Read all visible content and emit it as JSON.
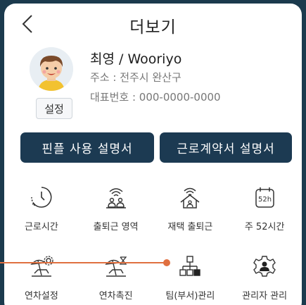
{
  "header": {
    "title": "더보기",
    "back_icon": "chevron-left-icon"
  },
  "profile": {
    "name": "최영 / Wooriyo",
    "address": "주소 : 전주시 완산구",
    "phone": "대표번호 : 000-0000-0000",
    "settings_label": "설정"
  },
  "buttons": {
    "manual": "핀플 사용 설명서",
    "contract_manual": "근로계약서 설명서"
  },
  "menu": [
    {
      "label": "근로시간",
      "icon": "clock-icon"
    },
    {
      "label": "출퇴근 영역",
      "icon": "commute-area-icon"
    },
    {
      "label": "재택 출퇴근",
      "icon": "home-wifi-icon"
    },
    {
      "label": "주 52시간",
      "icon": "calendar-52h-icon",
      "icon_text": "52h"
    },
    {
      "label": "연차설정",
      "icon": "vacation-settings-icon"
    },
    {
      "label": "연차촉진",
      "icon": "vacation-promotion-icon"
    },
    {
      "label": "팀(부서)관리",
      "icon": "org-chart-icon"
    },
    {
      "label": "관리자 관리",
      "icon": "admin-gear-icon"
    }
  ],
  "colors": {
    "background": "#1b3a4d",
    "button": "#1c3a52",
    "pointer": "#e07040"
  }
}
